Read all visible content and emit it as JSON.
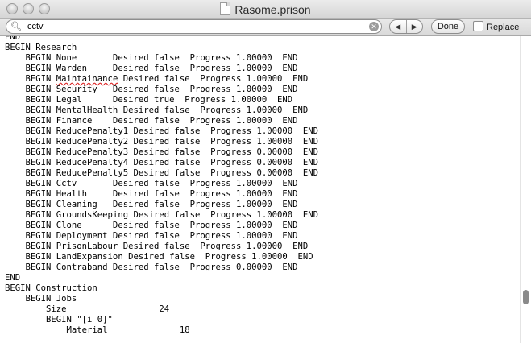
{
  "window": {
    "title": "Rasome.prison"
  },
  "find_bar": {
    "query": "cctv",
    "done_label": "Done",
    "replace_label": "Replace",
    "prev_symbol": "◀",
    "next_symbol": "▶"
  },
  "document": {
    "lines": [
      "END",
      "BEGIN Research",
      "    BEGIN None       Desired false  Progress 1.00000  END",
      "    BEGIN Warden     Desired false  Progress 1.00000  END",
      "    BEGIN Maintainance Desired false  Progress 1.00000  END",
      "    BEGIN Security   Desired false  Progress 1.00000  END",
      "    BEGIN Legal      Desired true  Progress 1.00000  END",
      "    BEGIN MentalHealth Desired false  Progress 1.00000  END",
      "    BEGIN Finance    Desired false  Progress 1.00000  END",
      "    BEGIN ReducePenalty1 Desired false  Progress 1.00000  END",
      "    BEGIN ReducePenalty2 Desired false  Progress 1.00000  END",
      "    BEGIN ReducePenalty3 Desired false  Progress 0.00000  END",
      "    BEGIN ReducePenalty4 Desired false  Progress 0.00000  END",
      "    BEGIN ReducePenalty5 Desired false  Progress 0.00000  END",
      "    BEGIN Cctv       Desired false  Progress 1.00000  END",
      "    BEGIN Health     Desired false  Progress 1.00000  END",
      "    BEGIN Cleaning   Desired false  Progress 1.00000  END",
      "    BEGIN GroundsKeeping Desired false  Progress 1.00000  END",
      "    BEGIN Clone      Desired false  Progress 1.00000  END",
      "    BEGIN Deployment Desired false  Progress 1.00000  END",
      "    BEGIN PrisonLabour Desired false  Progress 1.00000  END",
      "    BEGIN LandExpansion Desired false  Progress 1.00000  END",
      "    BEGIN Contraband Desired false  Progress 0.00000  END",
      "END",
      "BEGIN Construction",
      "    BEGIN Jobs",
      "        Size                  24",
      "        BEGIN \"[i 0]\"",
      "            Material              18"
    ],
    "misspelled_word": "Maintainance"
  }
}
